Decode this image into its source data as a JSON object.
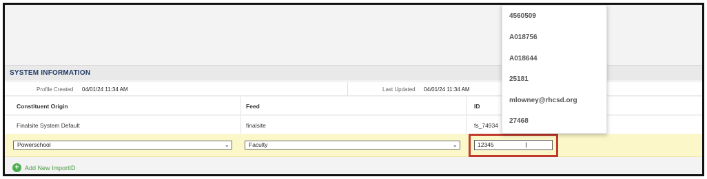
{
  "section": {
    "title": "SYSTEM INFORMATION"
  },
  "profile": {
    "created_label": "Profile Created",
    "created_value": "04/01/24 11:34 AM",
    "updated_label": "Last Updated",
    "updated_value": "04/01/24 11:34 AM"
  },
  "grid": {
    "headers": [
      "Constituent Origin",
      "Feed",
      "ID"
    ],
    "row": {
      "origin": "Finalsite System Default",
      "feed": "finalsite",
      "id": "fs_74934"
    },
    "edit": {
      "origin_selected": "Powerschool",
      "feed_selected": "Faculty",
      "id_value": "12345"
    }
  },
  "add_link": "Add New ImportID",
  "autocomplete": {
    "items": [
      "4560509",
      "A018756",
      "A018644",
      "25181",
      "mlowney@rhcsd.org",
      "27468"
    ]
  },
  "colors": {
    "highlight": "#c0392b",
    "edit_row": "#fbf7c9",
    "title": "#1f3b66",
    "add": "#4caf50"
  }
}
